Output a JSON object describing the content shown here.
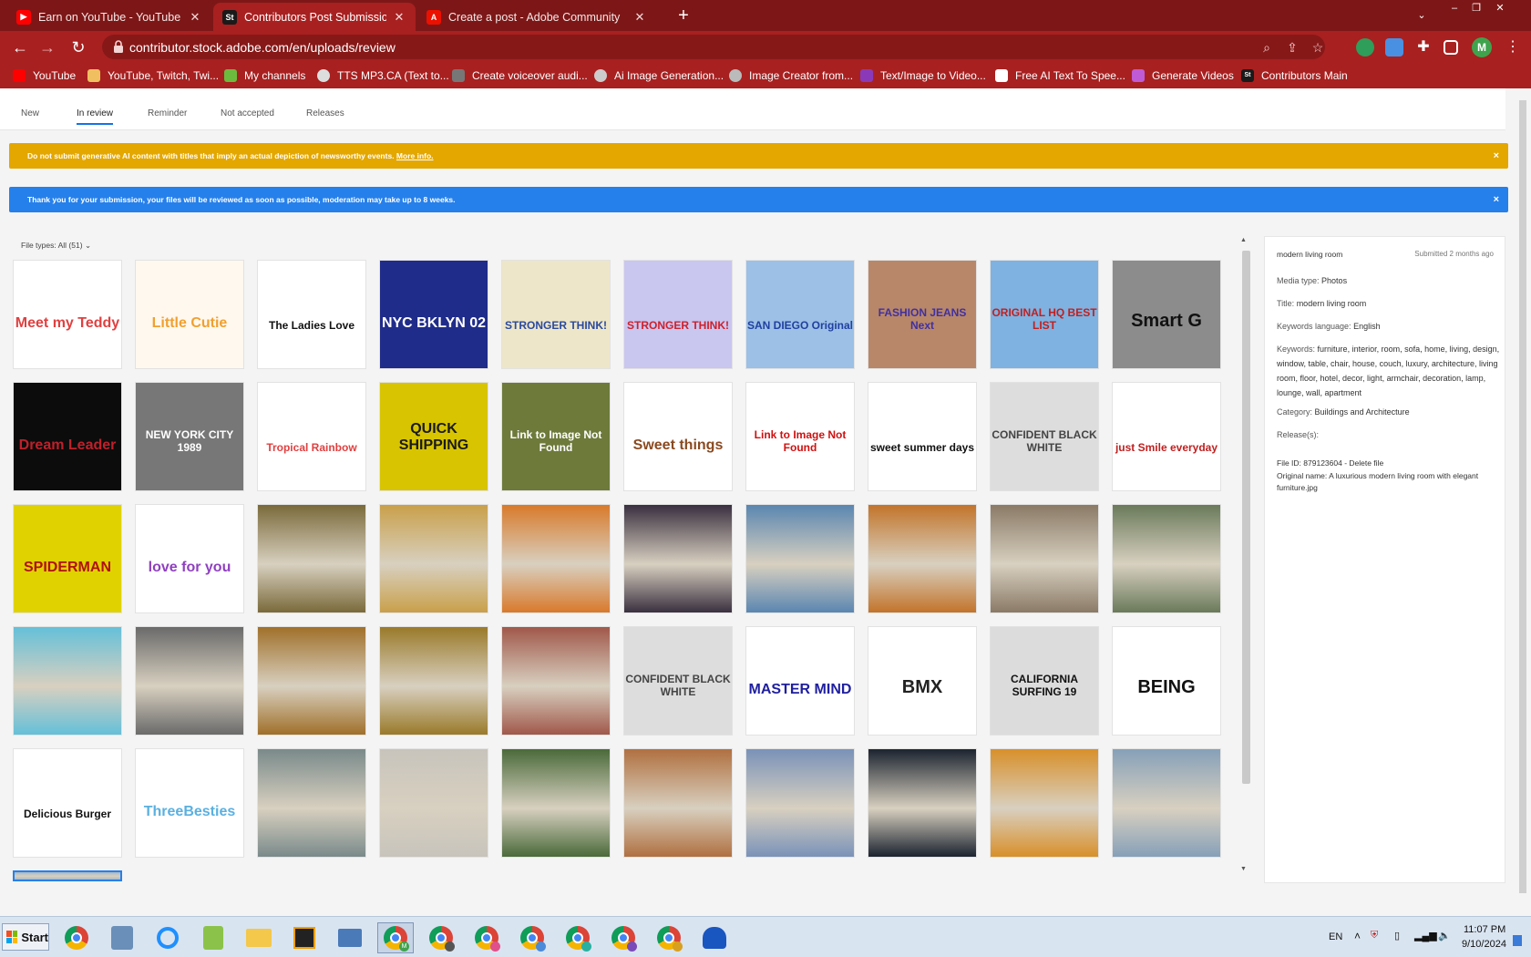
{
  "browser": {
    "tabs": [
      {
        "title": "Earn on YouTube - YouTube Studio",
        "icon": "youtube-icon",
        "color": "#ff0000",
        "active": false
      },
      {
        "title": "Contributors Post Submission - In Re",
        "icon": "adobe-stock-icon",
        "color": "#1a1a1a",
        "active": true,
        "glyph": "St"
      },
      {
        "title": "Create a post - Adobe Community",
        "icon": "adobe-icon",
        "color": "#eb1000",
        "active": false
      }
    ],
    "url": "contributor.stock.adobe.com/en/uploads/review",
    "profile_initial": "M",
    "bookmarks": [
      {
        "label": "YouTube",
        "color": "#ff0000"
      },
      {
        "label": "YouTube, Twitch, Twi...",
        "color": "#f0c060"
      },
      {
        "label": "My channels",
        "color": "#6dbb3e"
      },
      {
        "label": "TTS MP3.CA (Text to...",
        "color": "#dddddd"
      },
      {
        "label": "Create voiceover audi...",
        "color": "#777777"
      },
      {
        "label": "Ai Image Generation...",
        "color": "#cccccc"
      },
      {
        "label": "Image Creator from...",
        "color": "#bbbbbb"
      },
      {
        "label": "Text/Image to Video...",
        "color": "#8a3ab9"
      },
      {
        "label": "Free AI Text To Spee...",
        "color": "#ffffff"
      },
      {
        "label": "Generate Videos",
        "color": "#c05bd6"
      },
      {
        "label": "Contributors Main",
        "color": "#1a1a1a",
        "glyph": "St"
      }
    ]
  },
  "subnav": {
    "tabs": [
      "New",
      "In review",
      "Reminder",
      "Not accepted",
      "Releases"
    ],
    "active": "In review"
  },
  "alerts": {
    "warning": {
      "text": "Do not submit generative AI content with titles that imply an actual depiction of newsworthy events.",
      "link": "More info."
    },
    "info": {
      "text": "Thank you for your submission, your files will be reviewed as soon as possible, moderation may take up to 8 weeks."
    },
    "close": "×"
  },
  "filter": {
    "label": "File types: All (51)"
  },
  "thumbnails": [
    {
      "label": "Meet my Teddy",
      "bg": "#ffffff",
      "fg": "#e04040"
    },
    {
      "label": "Little Cutie",
      "bg": "#fff8ee",
      "fg": "#f0a030"
    },
    {
      "label": "The Ladies Love",
      "bg": "#ffffff",
      "fg": "#111111"
    },
    {
      "label": "NYC BKLYN 02",
      "bg": "#1f2c8a",
      "fg": "#ffffff"
    },
    {
      "label": "STRONGER THINK!",
      "bg": "#eee6c8",
      "fg": "#2a4aa0"
    },
    {
      "label": "STRONGER THINK!",
      "bg": "#c9c6f0",
      "fg": "#d0202a"
    },
    {
      "label": "SAN DIEGO Original",
      "bg": "#9cc0e6",
      "fg": "#2040a0"
    },
    {
      "label": "FASHION JEANS Next",
      "bg": "#b8876a",
      "fg": "#4030a0"
    },
    {
      "label": "ORIGINAL HQ BEST LIST",
      "bg": "#7fb2e0",
      "fg": "#c02020"
    },
    {
      "label": "Smart G",
      "bg": "#8c8c8c",
      "fg": "#111111"
    },
    {
      "label": "Dream Leader",
      "bg": "#0c0c0c",
      "fg": "#c0202a"
    },
    {
      "label": "NEW YORK CITY 1989",
      "bg": "#777777",
      "fg": "#ffffff"
    },
    {
      "label": "Tropical Rainbow",
      "bg": "#ffffff",
      "fg": "#e04040"
    },
    {
      "label": "QUICK SHIPPING",
      "bg": "#d8c400",
      "fg": "#1a1a1a"
    },
    {
      "label": "Link to Image Not Found",
      "bg": "#6d7a3a",
      "fg": "#ffffff"
    },
    {
      "label": "Sweet things",
      "bg": "#ffffff",
      "fg": "#8a4a20"
    },
    {
      "label": "Link to Image Not Found",
      "bg": "#ffffff",
      "fg": "#d01010"
    },
    {
      "label": "sweet summer days",
      "bg": "#ffffff",
      "fg": "#111111"
    },
    {
      "label": "CONFIDENT BLACK WHITE",
      "bg": "#dddddd",
      "fg": "#444444"
    },
    {
      "label": "just Smile everyday",
      "bg": "#ffffff",
      "fg": "#c02020"
    },
    {
      "label": "SPIDERMAN",
      "bg": "#e0d200",
      "fg": "#b01010"
    },
    {
      "label": "love for you",
      "bg": "#ffffff",
      "fg": "#9040c0"
    },
    {
      "label": "",
      "bg": "#7a6a3a",
      "fg": "#ffffff"
    },
    {
      "label": "",
      "bg": "#c9a04a",
      "fg": "#ffffff"
    },
    {
      "label": "",
      "bg": "#d87a2a",
      "fg": "#ffffff"
    },
    {
      "label": "",
      "bg": "#3a3040",
      "fg": "#ffffff"
    },
    {
      "label": "",
      "bg": "#5a86b0",
      "fg": "#ffffff"
    },
    {
      "label": "",
      "bg": "#c2742a",
      "fg": "#ffffff"
    },
    {
      "label": "",
      "bg": "#8a7a66",
      "fg": "#ffffff"
    },
    {
      "label": "",
      "bg": "#6a7a5a",
      "fg": "#ffffff"
    },
    {
      "label": "",
      "bg": "#64c0d8",
      "fg": "#ffffff"
    },
    {
      "label": "",
      "bg": "#6a6a6a",
      "fg": "#ffffff"
    },
    {
      "label": "",
      "bg": "#a0702a",
      "fg": "#ffffff"
    },
    {
      "label": "",
      "bg": "#9a7a2a",
      "fg": "#ffffff"
    },
    {
      "label": "",
      "bg": "#a0584a",
      "fg": "#ffffff"
    },
    {
      "label": "CONFIDENT BLACK WHITE",
      "bg": "#dddddd",
      "fg": "#444444"
    },
    {
      "label": "MASTER MIND",
      "bg": "#ffffff",
      "fg": "#2020a0"
    },
    {
      "label": "BMX",
      "bg": "#ffffff",
      "fg": "#222222"
    },
    {
      "label": "CALIFORNIA SURFING 19",
      "bg": "#dcdcdc",
      "fg": "#111111"
    },
    {
      "label": "BEING",
      "bg": "#ffffff",
      "fg": "#111111"
    },
    {
      "label": "Delicious Burger",
      "bg": "#ffffff",
      "fg": "#111111"
    },
    {
      "label": "ThreeBesties",
      "bg": "#ffffff",
      "fg": "#5ab0e0"
    },
    {
      "label": "",
      "bg": "#7a8a8a",
      "fg": "#ffffff"
    },
    {
      "label": "",
      "bg": "#c8c4bc",
      "fg": "#ffffff"
    },
    {
      "label": "",
      "bg": "#4a6a3a",
      "fg": "#ffffff"
    },
    {
      "label": "",
      "bg": "#b07040",
      "fg": "#ffffff"
    },
    {
      "label": "",
      "bg": "#7a92b8",
      "fg": "#ffffff"
    },
    {
      "label": "",
      "bg": "#1c2430",
      "fg": "#ffffff"
    },
    {
      "label": "",
      "bg": "#d8902a",
      "fg": "#ffffff"
    },
    {
      "label": "",
      "bg": "#86a0b8",
      "fg": "#ffffff"
    },
    {
      "label": "",
      "bg": "#a8b8c8",
      "fg": "#ffffff"
    }
  ],
  "details": {
    "title": "modern living room",
    "submitted": "Submitted 2 months ago",
    "media_type_label": "Media type:",
    "media_type": "Photos",
    "title_label": "Title:",
    "title_value": "modern living room",
    "keywords_language_label": "Keywords language:",
    "keywords_language": "English",
    "keywords_label": "Keywords:",
    "keywords": "furniture, interior, room, sofa, home, living, design, window, table, chair, house, couch, luxury, architecture, living room, floor, hotel, decor, light, armchair, decoration, lamp, lounge, wall, apartment",
    "category_label": "Category:",
    "category": "Buildings and Architecture",
    "releases_label": "Release(s):",
    "file_id": "File ID: 879123604 - Delete file",
    "original_name": "Original name: A luxurious modern living room with elegant furniture.jpg"
  },
  "taskbar": {
    "start": "Start",
    "language": "EN",
    "time": "11:07 PM",
    "date": "9/10/2024"
  }
}
